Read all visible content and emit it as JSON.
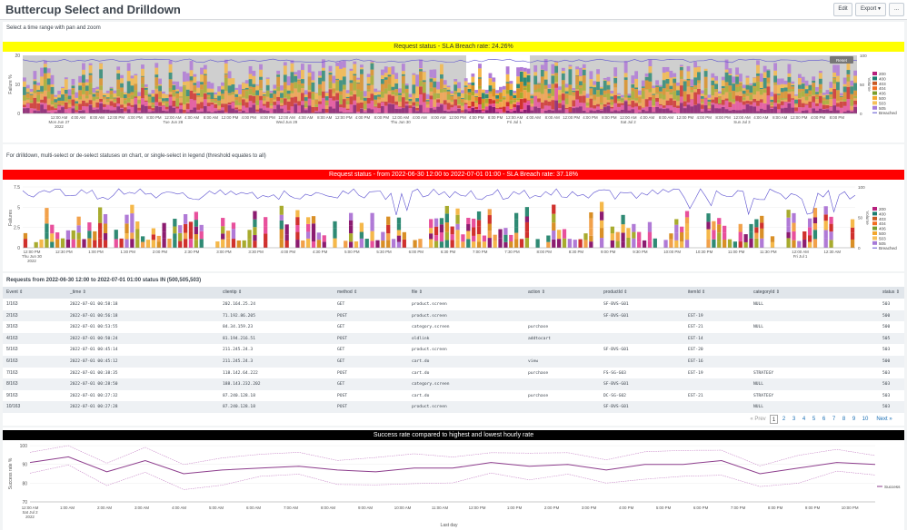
{
  "header": {
    "title": "Buttercup Select and Drilldown",
    "edit_label": "Edit",
    "export_label": "Export",
    "more_label": "..."
  },
  "panel1": {
    "description": "Select a time range with pan and zoom",
    "banner": "Request status - SLA Breach rate: 24.26%",
    "banner_color": "#ffff00",
    "reset_label": "Reset",
    "y_label": "Failure %",
    "y2_label": "Volume",
    "yticks": [
      "20",
      "10",
      "0"
    ],
    "y2ticks": [
      "100",
      "50",
      "0"
    ],
    "xticks": [
      [
        "12:00 AM",
        "Mon Jun 27",
        "2022"
      ],
      [
        "4:00 AM"
      ],
      [
        "8:00 AM"
      ],
      [
        "12:00 PM"
      ],
      [
        "4:00 PM"
      ],
      [
        "8:00 PM"
      ],
      [
        "12:00 AM",
        "Tue Jun 28"
      ],
      [
        "4:00 AM"
      ],
      [
        "8:00 AM"
      ],
      [
        "12:00 PM"
      ],
      [
        "4:00 PM"
      ],
      [
        "8:00 PM"
      ],
      [
        "12:00 AM",
        "Wed Jun 29"
      ],
      [
        "4:00 AM"
      ],
      [
        "8:00 AM"
      ],
      [
        "12:00 PM"
      ],
      [
        "4:00 PM"
      ],
      [
        "8:00 PM"
      ],
      [
        "12:00 AM",
        "Thu Jun 30"
      ],
      [
        "4:00 AM"
      ],
      [
        "8:00 AM"
      ],
      [
        "12:00 PM"
      ],
      [
        "4:00 PM"
      ],
      [
        "8:00 PM"
      ],
      [
        "12:00 AM",
        "Fri Jul 1"
      ],
      [
        "4:00 AM"
      ],
      [
        "8:00 AM"
      ],
      [
        "12:00 PM"
      ],
      [
        "4:00 PM"
      ],
      [
        "8:00 PM"
      ],
      [
        "12:00 AM",
        "Sat Jul 2"
      ],
      [
        "4:00 AM"
      ],
      [
        "8:00 AM"
      ],
      [
        "12:00 PM"
      ],
      [
        "4:00 PM"
      ],
      [
        "8:00 PM"
      ],
      [
        "12:00 AM",
        "Sun Jul 3"
      ],
      [
        "4:00 AM"
      ],
      [
        "8:00 AM"
      ],
      [
        "12:00 PM"
      ],
      [
        "4:00 PM"
      ],
      [
        "8:00 PM"
      ]
    ],
    "legend": [
      "200",
      "400",
      "403",
      "404",
      "406",
      "500",
      "503",
      "505",
      "Breached"
    ]
  },
  "panel2": {
    "description": "For drilldown, multi-select or de-select statuses on chart, or single-select in legend (threshold equates to all)",
    "banner": "Request status - from 2022-06-30 12:00 to 2022-07-01 01:00 - SLA Breach rate: 37.18%",
    "banner_color": "#ff0000",
    "y_label": "Failures",
    "y2_label": "Volume",
    "yticks": [
      "7.5",
      "5",
      "2.5",
      "0"
    ],
    "y2ticks": [
      "100",
      "50",
      "0"
    ],
    "xticks": [
      [
        "12:00 PM",
        "Thu Jun 30",
        "2022"
      ],
      [
        "12:30 PM"
      ],
      [
        "1:00 PM"
      ],
      [
        "1:30 PM"
      ],
      [
        "2:00 PM"
      ],
      [
        "2:30 PM"
      ],
      [
        "3:00 PM"
      ],
      [
        "3:30 PM"
      ],
      [
        "4:00 PM"
      ],
      [
        "4:30 PM"
      ],
      [
        "5:00 PM"
      ],
      [
        "5:30 PM"
      ],
      [
        "6:00 PM"
      ],
      [
        "6:30 PM"
      ],
      [
        "7:00 PM"
      ],
      [
        "7:30 PM"
      ],
      [
        "8:00 PM"
      ],
      [
        "8:30 PM"
      ],
      [
        "9:00 PM"
      ],
      [
        "9:30 PM"
      ],
      [
        "10:00 PM"
      ],
      [
        "10:30 PM"
      ],
      [
        "11:00 PM"
      ],
      [
        "11:30 PM"
      ],
      [
        "12:00 AM",
        "Fri Jul 1"
      ],
      [
        "12:30 AM"
      ]
    ],
    "legend": [
      "200",
      "400",
      "403",
      "404",
      "406",
      "500",
      "503",
      "505",
      "Breached"
    ]
  },
  "table": {
    "title": "Requests from 2022-06-30 12:00 to 2022-07-01 01:00 status IN (500,505,503)",
    "columns": [
      "Event",
      "_time",
      "clientip",
      "method",
      "file",
      "action",
      "productId",
      "itemId",
      "categoryId",
      "status"
    ],
    "rows": [
      [
        "1/163",
        "2022-07-01 00:58:18",
        "202.164.25.24",
        "GET",
        "product.screen",
        "",
        "SF-BVS-G01",
        "",
        "NULL",
        "503"
      ],
      [
        "2/163",
        "2022-07-01 00:56:18",
        "71.192.86.205",
        "POST",
        "product.screen",
        "",
        "SF-BVS-G01",
        "EST-19",
        "",
        "500"
      ],
      [
        "3/163",
        "2022-07-01 00:53:55",
        "84.34.159.23",
        "GET",
        "category.screen",
        "purchase",
        "",
        "EST-21",
        "NULL",
        "500"
      ],
      [
        "4/163",
        "2022-07-01 00:50:24",
        "81.194.216.51",
        "POST",
        "oldlink",
        "addtocart",
        "",
        "EST-14",
        "",
        "505"
      ],
      [
        "5/163",
        "2022-07-01 00:45:14",
        "211.245.24.3",
        "GET",
        "product.screen",
        "",
        "SF-BVS-G01",
        "EST-20",
        "",
        "503"
      ],
      [
        "6/163",
        "2022-07-01 00:45:12",
        "211.245.24.3",
        "GET",
        "cart.do",
        "view",
        "",
        "EST-16",
        "",
        "500"
      ],
      [
        "7/163",
        "2022-07-01 00:38:35",
        "118.142.64.222",
        "POST",
        "cart.do",
        "purchase",
        "FS-SG-G03",
        "EST-19",
        "STRATEGY",
        "503"
      ],
      [
        "8/163",
        "2022-07-01 00:28:50",
        "188.143.232.202",
        "GET",
        "category.screen",
        "",
        "SF-BVS-G01",
        "",
        "NULL",
        "503"
      ],
      [
        "9/163",
        "2022-07-01 00:27:32",
        "87.240.128.18",
        "POST",
        "cart.do",
        "purchase",
        "DC-SG-G02",
        "EST-21",
        "STRATEGY",
        "503"
      ],
      [
        "10/163",
        "2022-07-01 00:27:28",
        "87.240.128.18",
        "POST",
        "product.screen",
        "",
        "SF-BVS-G01",
        "",
        "NULL",
        "503"
      ]
    ],
    "pagination": {
      "prev": "« Prev",
      "pages": [
        "1",
        "2",
        "3",
        "4",
        "5",
        "6",
        "7",
        "8",
        "9",
        "10"
      ],
      "current": "1",
      "next": "Next »"
    }
  },
  "panel3": {
    "banner": "Success rate compared to highest and lowest hourly rate",
    "banner_color": "#000000",
    "y_label": "Success rate %",
    "x_label": "Last day",
    "yticks": [
      "100",
      "90",
      "80",
      "70"
    ],
    "xticks": [
      [
        "12:00 AM",
        "Sat Jul 2",
        "2022"
      ],
      [
        "1:00 AM"
      ],
      [
        "2:00 AM"
      ],
      [
        "3:00 AM"
      ],
      [
        "4:00 AM"
      ],
      [
        "5:00 AM"
      ],
      [
        "6:00 AM"
      ],
      [
        "7:00 AM"
      ],
      [
        "8:00 AM"
      ],
      [
        "9:00 AM"
      ],
      [
        "10:00 AM"
      ],
      [
        "11:00 AM"
      ],
      [
        "12:00 PM"
      ],
      [
        "1:00 PM"
      ],
      [
        "2:00 PM"
      ],
      [
        "3:00 PM"
      ],
      [
        "4:00 PM"
      ],
      [
        "5:00 PM"
      ],
      [
        "6:00 PM"
      ],
      [
        "7:00 PM"
      ],
      [
        "8:00 PM"
      ],
      [
        "9:00 PM"
      ],
      [
        "10:00 PM"
      ]
    ],
    "legend": "Success"
  },
  "colors": {
    "200": "#1e93c6",
    "400": "#f2b827",
    "403": "#d6563c",
    "404": "#6a5c9e",
    "406": "#31a35f",
    "500": "#ed8440",
    "503": "#3863a0",
    "505": "#a2cc3e",
    "Breached": "#5a4fcf"
  }
}
